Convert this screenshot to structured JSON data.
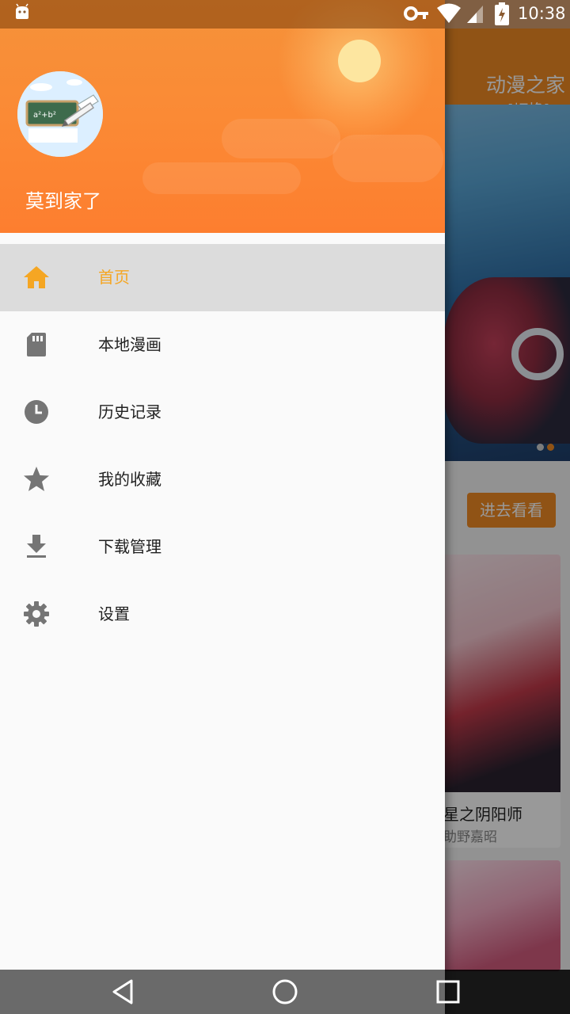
{
  "status_bar": {
    "time": "10:38",
    "icons": [
      "android-robot-icon",
      "vpn-key-icon",
      "wifi-icon",
      "cell-signal-icon",
      "battery-charging-icon"
    ]
  },
  "background_app": {
    "title": "动漫之家",
    "switch_label": "[切换]",
    "more_button": "进去看看",
    "card": {
      "title": "星之阴阳师",
      "author": "助野嘉昭"
    },
    "carousel_dot_colors": [
      "#9e9e9e",
      "#f08a24"
    ]
  },
  "drawer": {
    "user_name": "莫到家了",
    "menu": [
      {
        "label": "首页",
        "icon": "home-icon",
        "active": true
      },
      {
        "label": "本地漫画",
        "icon": "sd-card-icon",
        "active": false
      },
      {
        "label": "历史记录",
        "icon": "clock-icon",
        "active": false
      },
      {
        "label": "我的收藏",
        "icon": "star-icon",
        "active": false
      },
      {
        "label": "下载管理",
        "icon": "download-icon",
        "active": false
      },
      {
        "label": "设置",
        "icon": "gear-icon",
        "active": false
      }
    ]
  },
  "colors": {
    "accent": "#f5a623",
    "header_orange": "#fb8a35",
    "active_row": "#dcdcdc"
  },
  "nav_bar": {
    "buttons": [
      "back-icon",
      "home-circle-icon",
      "recents-icon"
    ]
  }
}
